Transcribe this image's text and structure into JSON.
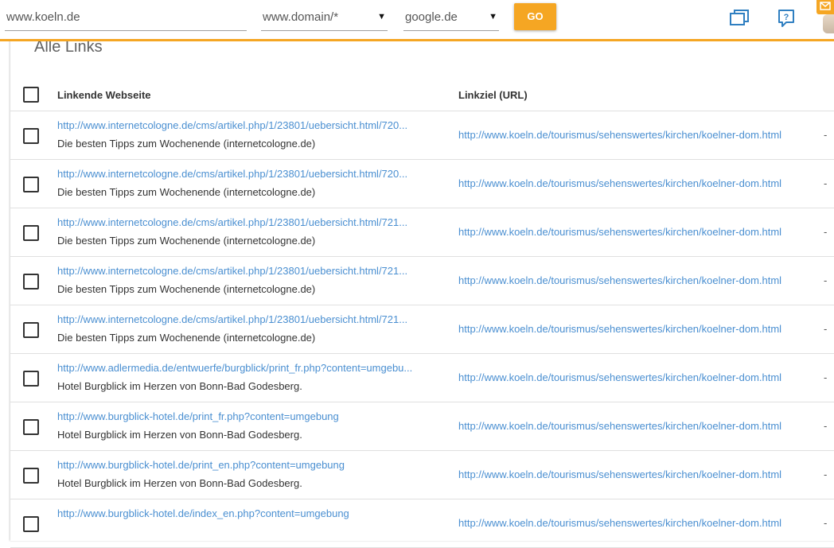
{
  "search": {
    "domain_value": "www.koeln.de",
    "mode_value": "www.domain/*",
    "engine_value": "google.de",
    "go_label": "GO"
  },
  "icons": {
    "windows": "windows-icon",
    "help": "help-icon",
    "mail": "mail-icon"
  },
  "colors": {
    "accent": "#f5a623",
    "link": "#4a8fd1"
  },
  "card": {
    "title": "Alle Links"
  },
  "table": {
    "headers": {
      "source": "Linkende Webseite",
      "target": "Linkziel (URL)"
    },
    "rows": [
      {
        "source_url": "http://www.internetcologne.de/cms/artikel.php/1/23801/uebersicht.html/720...",
        "source_title": "Die besten Tipps zum Wochenende (internetcologne.de)",
        "target_url": "http://www.koeln.de/tourismus/sehenswertes/kirchen/koelner-dom.html",
        "extra": "-"
      },
      {
        "source_url": "http://www.internetcologne.de/cms/artikel.php/1/23801/uebersicht.html/720...",
        "source_title": "Die besten Tipps zum Wochenende (internetcologne.de)",
        "target_url": "http://www.koeln.de/tourismus/sehenswertes/kirchen/koelner-dom.html",
        "extra": "-"
      },
      {
        "source_url": "http://www.internetcologne.de/cms/artikel.php/1/23801/uebersicht.html/721...",
        "source_title": "Die besten Tipps zum Wochenende (internetcologne.de)",
        "target_url": "http://www.koeln.de/tourismus/sehenswertes/kirchen/koelner-dom.html",
        "extra": "-"
      },
      {
        "source_url": "http://www.internetcologne.de/cms/artikel.php/1/23801/uebersicht.html/721...",
        "source_title": "Die besten Tipps zum Wochenende (internetcologne.de)",
        "target_url": "http://www.koeln.de/tourismus/sehenswertes/kirchen/koelner-dom.html",
        "extra": "-"
      },
      {
        "source_url": "http://www.internetcologne.de/cms/artikel.php/1/23801/uebersicht.html/721...",
        "source_title": "Die besten Tipps zum Wochenende (internetcologne.de)",
        "target_url": "http://www.koeln.de/tourismus/sehenswertes/kirchen/koelner-dom.html",
        "extra": "-"
      },
      {
        "source_url": "http://www.adlermedia.de/entwuerfe/burgblick/print_fr.php?content=umgebu...",
        "source_title": "Hotel Burgblick im Herzen von Bonn-Bad Godesberg.",
        "target_url": "http://www.koeln.de/tourismus/sehenswertes/kirchen/koelner-dom.html",
        "extra": "-"
      },
      {
        "source_url": "http://www.burgblick-hotel.de/print_fr.php?content=umgebung",
        "source_title": "Hotel Burgblick im Herzen von Bonn-Bad Godesberg.",
        "target_url": "http://www.koeln.de/tourismus/sehenswertes/kirchen/koelner-dom.html",
        "extra": "-"
      },
      {
        "source_url": "http://www.burgblick-hotel.de/print_en.php?content=umgebung",
        "source_title": "Hotel Burgblick im Herzen von Bonn-Bad Godesberg.",
        "target_url": "http://www.koeln.de/tourismus/sehenswertes/kirchen/koelner-dom.html",
        "extra": "-"
      },
      {
        "source_url": "http://www.burgblick-hotel.de/index_en.php?content=umgebung",
        "source_title": "",
        "target_url": "http://www.koeln.de/tourismus/sehenswertes/kirchen/koelner-dom.html",
        "extra": "-"
      }
    ]
  }
}
